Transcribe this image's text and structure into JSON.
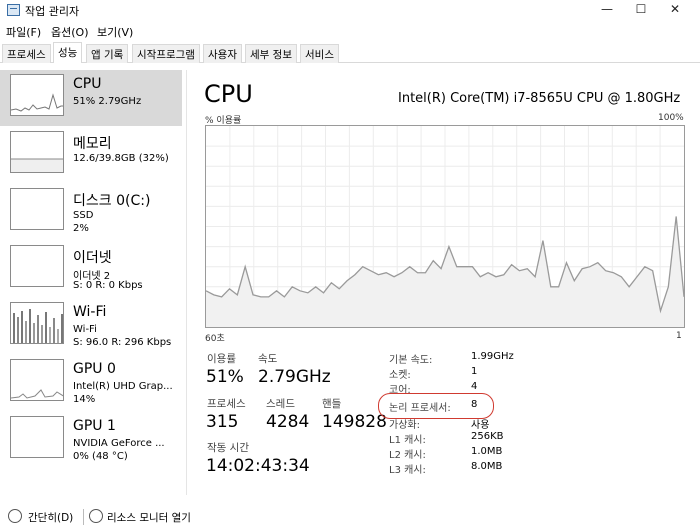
{
  "window": {
    "title": "작업 관리자",
    "minimize": "—",
    "maximize": "☐",
    "close": "✕"
  },
  "menu": [
    "파일(F)",
    "옵션(O)",
    "보기(V)"
  ],
  "tabs": [
    "프로세스",
    "성능",
    "앱 기록",
    "시작프로그램",
    "사용자",
    "세부 정보",
    "서비스"
  ],
  "active_tab": 1,
  "sidebar": [
    {
      "title": "CPU",
      "sub1": "51% 2.79GHz",
      "sub2": ""
    },
    {
      "title": "메모리",
      "sub1": "12.6/39.8GB (32%)",
      "sub2": ""
    },
    {
      "title": "디스크 0(C:)",
      "sub1": "SSD",
      "sub2": "2%"
    },
    {
      "title": "이더넷",
      "sub1": "이더넷 2",
      "sub2": "S: 0 R: 0 Kbps"
    },
    {
      "title": "Wi-Fi",
      "sub1": "Wi-Fi",
      "sub2": "S: 96.0 R: 296 Kbps"
    },
    {
      "title": "GPU 0",
      "sub1": "Intel(R) UHD Grap...",
      "sub2": "14%"
    },
    {
      "title": "GPU 1",
      "sub1": "NVIDIA GeForce ...",
      "sub2": "0% (48 °C)"
    }
  ],
  "main": {
    "title": "CPU",
    "model": "Intel(R) Core(TM) i7-8565U CPU @ 1.80GHz",
    "graph_caption": "% 이용률",
    "graph_max": "100%",
    "graph_left": "60초",
    "graph_right": "1",
    "usage_percent": [
      18,
      16,
      15,
      19,
      16,
      30,
      16,
      15,
      15,
      18,
      15,
      20,
      18,
      17,
      20,
      17,
      22,
      19,
      23,
      26,
      30,
      28,
      26,
      27,
      25,
      27,
      30,
      27,
      27,
      33,
      29,
      40,
      30,
      30,
      30,
      25,
      27,
      25,
      26,
      31,
      28,
      29,
      25,
      43,
      20,
      20,
      32,
      23,
      29,
      30,
      32,
      28,
      27,
      25,
      20,
      25,
      30,
      28,
      8,
      20,
      55,
      15
    ]
  },
  "stats": {
    "utilization_label": "이용률",
    "utilization_value": "51%",
    "speed_label": "속도",
    "speed_value": "2.79GHz",
    "processes_label": "프로세스",
    "processes_value": "315",
    "threads_label": "스레드",
    "threads_value": "4284",
    "handles_label": "핸들",
    "handles_value": "149828",
    "uptime_label": "작동 시간",
    "uptime_value": "14:02:43:34"
  },
  "specs": [
    {
      "label": "기본 속도:",
      "value": "1.99GHz"
    },
    {
      "label": "소켓:",
      "value": "1"
    },
    {
      "label": "코어:",
      "value": "4"
    },
    {
      "label": "논리 프로세서:",
      "value": "8"
    },
    {
      "label": "가상화:",
      "value": "사용"
    },
    {
      "label": "L1 캐시:",
      "value": "256KB"
    },
    {
      "label": "L2 캐시:",
      "value": "1.0MB"
    },
    {
      "label": "L3 캐시:",
      "value": "8.0MB"
    }
  ],
  "footer": {
    "collapse": "간단히(D)",
    "resmon": "리소스 모니터 열기"
  },
  "colors": {
    "graph_line": "#9a9a9a",
    "highlight": "#d03a30",
    "selected_bg": "#d9d9d9"
  }
}
